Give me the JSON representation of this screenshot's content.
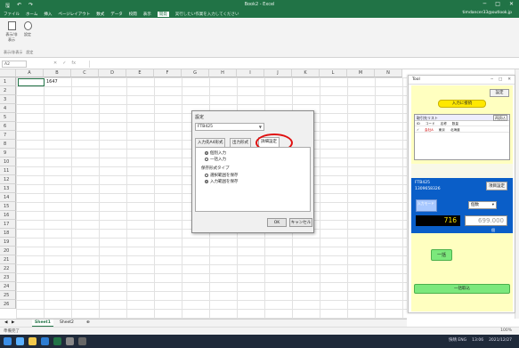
{
  "app": {
    "title": "Book2 - Excel",
    "user": "timdancer33@outlook.jp",
    "colors": {
      "brand": "#217346",
      "dialog_highlight": "#e01010",
      "panel_yellow": "#ffffc0",
      "panel_blue": "#0a5ec8"
    }
  },
  "ribbon": {
    "tabs": [
      "ファイル",
      "ホーム",
      "挿入",
      "ページレイアウト",
      "数式",
      "データ",
      "校閲",
      "表示",
      "開発"
    ],
    "active_tab": "開発",
    "tell_me": "実行したい作業を入力してください",
    "buttons": [
      "表示/非表示",
      "設定"
    ],
    "group_label": "表示/非表示　設定"
  },
  "formula_bar": {
    "name_box": "A2",
    "fx": "fx",
    "value": ""
  },
  "grid": {
    "columns": [
      "A",
      "B",
      "C",
      "D",
      "E",
      "F",
      "G",
      "H",
      "I",
      "J",
      "K",
      "L",
      "M",
      "N"
    ],
    "rows": [
      "1",
      "2",
      "3",
      "4",
      "5",
      "6",
      "7",
      "8",
      "9",
      "10",
      "11",
      "12",
      "13",
      "14",
      "15",
      "16",
      "17",
      "18",
      "19",
      "20",
      "21",
      "22",
      "23",
      "24",
      "25",
      "26"
    ],
    "b1_value": "1647"
  },
  "sheets": {
    "tabs": [
      "Sheet1",
      "Sheet2"
    ],
    "active": "Sheet1",
    "add": "⊕"
  },
  "status": {
    "left": "準備完了",
    "zoom": "100%"
  },
  "dialog": {
    "title": "設定",
    "select_value": "FTB425",
    "tabs": [
      "入力先A4形式",
      "出力形式",
      "詳細設定"
    ],
    "active_tab": "詳細設定",
    "group1_options": [
      "個別入力",
      "一括入力"
    ],
    "group2_title": "保存形式タイプ",
    "group2_options": [
      "選択範囲を保存",
      "入力範囲を保存"
    ],
    "ok": "OK",
    "cancel": "キャンセル"
  },
  "panel": {
    "title": "Tool",
    "settings": "設定",
    "yellow_button": "入力に接続",
    "list_header": "取引先リスト",
    "list_button": "再読込",
    "list_rows": [
      [
        "ID",
        "コード",
        "名称",
        "数量"
      ],
      [
        "✓",
        "会社A",
        "東京",
        "北海道"
      ]
    ],
    "mid_label": "FTB425",
    "mid_value": "1309658326",
    "mid_settings": "項目設定",
    "blue_btn": "入力モード",
    "unit": "個数",
    "num1": "716",
    "num2": "699.000",
    "small": "個",
    "green_btn": "一括",
    "green_btn2": "一括取込"
  },
  "taskbar": {
    "time": "13:06",
    "date": "2021/12/27",
    "tray_text": "快晴 ENG"
  }
}
